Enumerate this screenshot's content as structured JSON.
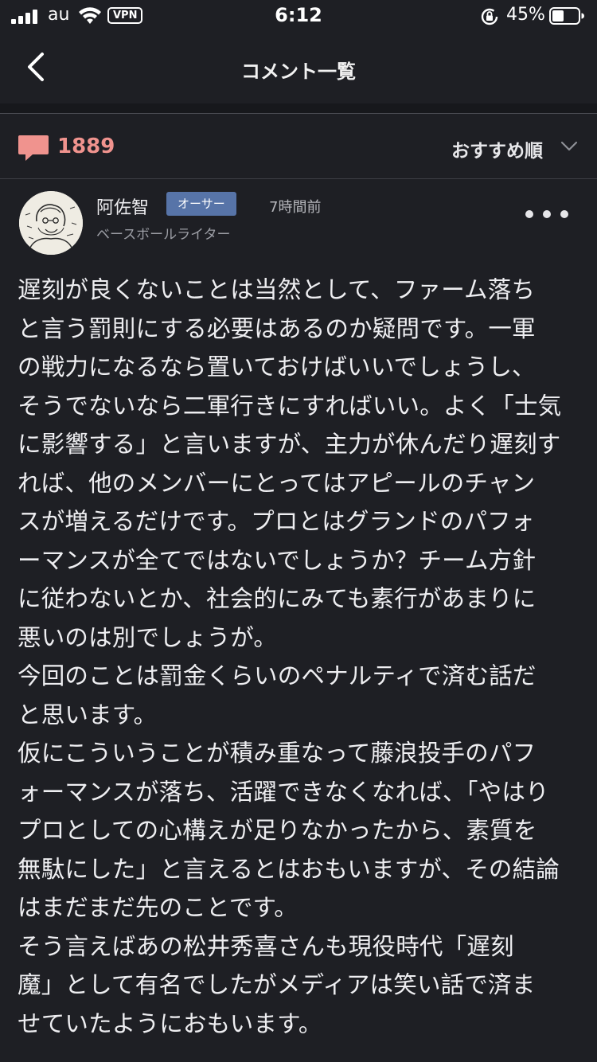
{
  "status_bar": {
    "carrier": "au",
    "vpn": "VPN",
    "time": "6:12",
    "battery": "45%",
    "battery_level": 0.45
  },
  "nav": {
    "title": "コメント一覧",
    "back_icon": "chevron-left-icon"
  },
  "comments_summary": {
    "count": "1889",
    "icon": "speech-bubble-icon",
    "icon_color": "#f0938e",
    "sort_label": "おすすめ順",
    "sort_icon": "chevron-down-icon"
  },
  "comment": {
    "author": "阿佐智",
    "badge": "オーサー",
    "time": "7時間前",
    "role": "ベースボールライター",
    "more_icon": "more-horizontal-icon",
    "lines": [
      "遅刻が良くないことは当然として、ファーム落ち",
      "と言う罰則にする必要はあるのか疑問です。一軍",
      "の戦力になるなら置いておけばいいでしょうし、",
      "そうでないなら二軍行きにすればいい。よく「士気",
      "に影響する」と言いますが、主力が休んだり遅刻す",
      "れば、他のメンバーにとってはアピールのチャン",
      "スが増えるだけです。プロとはグランドのパフォ",
      "ーマンスが全てではないでしょうか？チーム方針",
      "に従わないとか、社会的にみても素行があまりに",
      "悪いのは別でしょうが。",
      "今回のことは罰金くらいのペナルティで済む話だ",
      "と思います。",
      "仮にこういうことが積み重なって藤浪投手のパフ",
      "ォーマンスが落ち、活躍できなくなれば、「やはり",
      "プロとしての心構えが足りなかったから、素質を",
      "無駄にした」と言えるとはおもいますが、その結論",
      "はまだまだ先のことです。",
      "そう言えばあの松井秀喜さんも現役時代「遅刻",
      "魔」として有名でしたがメディアは笑い話で済ま",
      "せていたようにおもいます。"
    ]
  },
  "colors": {
    "background": "#1e1f24",
    "accent": "#f0938e",
    "badge": "#5774a8"
  }
}
